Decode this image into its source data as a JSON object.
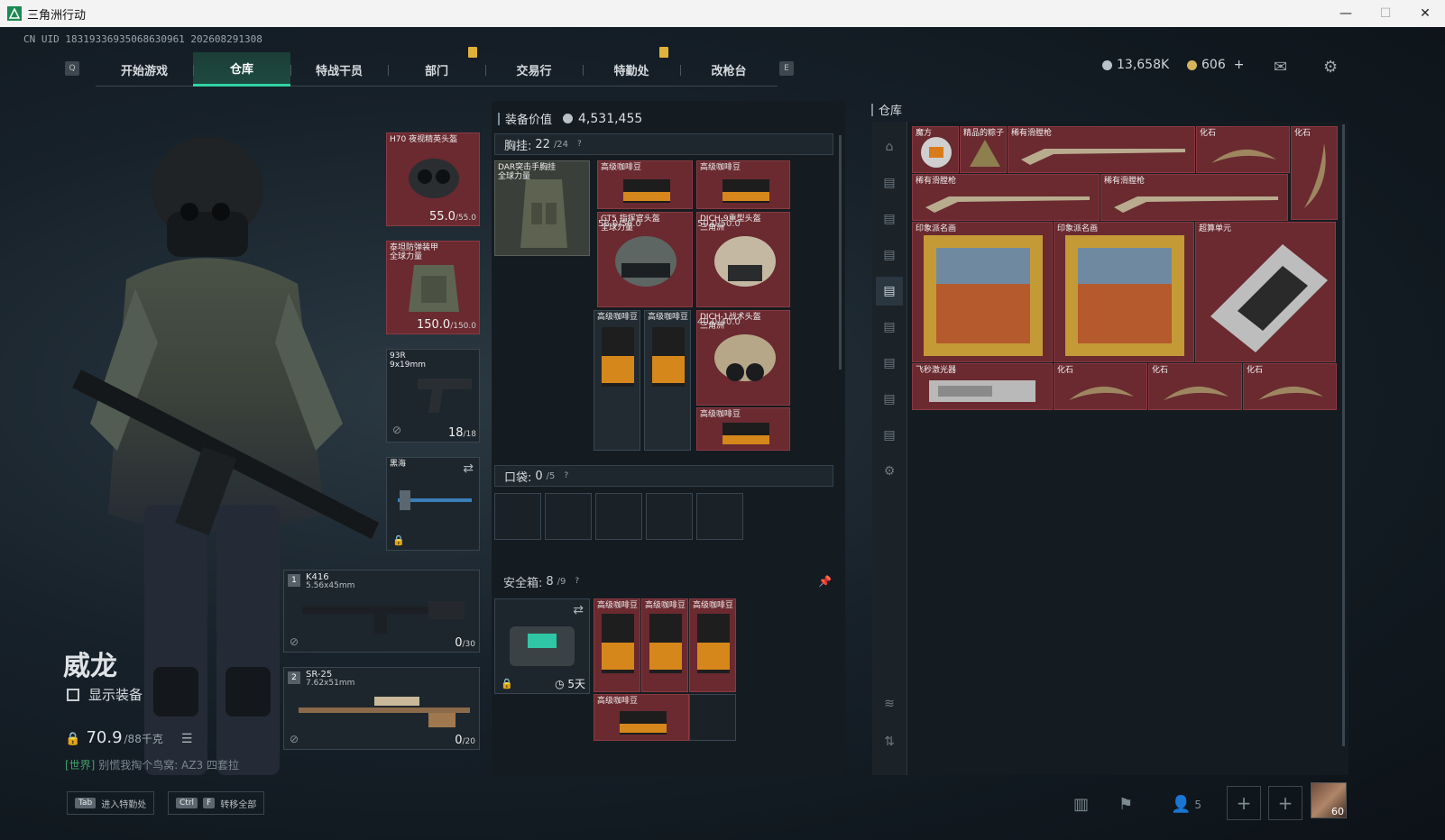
{
  "window": {
    "title": "三角洲行动"
  },
  "uid_text": "CN UID 18319336935068630961 202608291308",
  "nav": {
    "left_key": "Q",
    "right_key": "E",
    "tabs": [
      "开始游戏",
      "仓库",
      "特战干员",
      "部门",
      "交易行",
      "特勤处",
      "改枪台"
    ],
    "active": "仓库"
  },
  "currency": {
    "coins": "13,658K",
    "tickets": "606",
    "plus": "+"
  },
  "character": {
    "name": "威龙",
    "show_gear_label": "显示装备",
    "weight_value": "70.9",
    "weight_max": "/88千克",
    "chat_channel": "[世界]",
    "chat_msg": "别慌我掏个鸟窝: AZ3 四套拉"
  },
  "gear": {
    "helmet": {
      "label": "H70 夜视精英头盔",
      "dur": "55.0",
      "max": "/55.0"
    },
    "armor": {
      "label": "泰坦防弹装甲\n全球力量",
      "dur": "150.0",
      "max": "/150.0"
    },
    "pistol": {
      "label": "93R\n9x19mm",
      "ammo": "18",
      "max": "/18"
    },
    "melee": {
      "label": "黑海"
    },
    "primary": {
      "slot": "1",
      "label": "K416",
      "caliber": "5.56x45mm",
      "ammo": "0",
      "max": "/30"
    },
    "secondary": {
      "slot": "2",
      "label": "SR-25",
      "caliber": "7.62x51mm",
      "ammo": "0",
      "max": "/20"
    }
  },
  "equipment": {
    "value_label": "装备价值",
    "value": "4,531,455",
    "chest_label": "胸挂:",
    "chest_used": "22",
    "chest_max": "/24",
    "chest_rig": "DAR突击手胸挂\n全球力量",
    "items": {
      "coffee": "高级咖啡豆",
      "gt5": "GT5 指挥官头盔\n全球力量",
      "gt5_dur": "58.0/58.0",
      "dich9": "DICH-9重型头盔\n三角洲",
      "dich9_dur": "50.0/50.0",
      "dich1": "DICH-1战术头盔\n三角洲",
      "dich1_dur": "40.0/40.0"
    },
    "pocket_label": "口袋:",
    "pocket_used": "0",
    "pocket_max": "/5",
    "safe_label": "安全箱:",
    "safe_used": "8",
    "safe_max": "/9",
    "safe_timer": "5天"
  },
  "storage": {
    "title": "仓库",
    "items": {
      "cube": "魔方",
      "zongzi": "精品的粽子",
      "rare_rifle": "稀有滑膛枪",
      "fossil": "化石",
      "painting": "印象派名画",
      "supercomputer": "超算单元",
      "laser": "飞秒激光器"
    }
  },
  "bottom": {
    "tab_key": "Tab",
    "tab_label": "进入特勤处",
    "ctrl_key": "Ctrl",
    "f_key": "F",
    "transfer_label": "转移全部",
    "team_count": "5",
    "avatar_level": "60"
  },
  "colors": {
    "accent": "#2fd3a0",
    "item_red": "#6a2a30",
    "bg": "#0f1418"
  }
}
